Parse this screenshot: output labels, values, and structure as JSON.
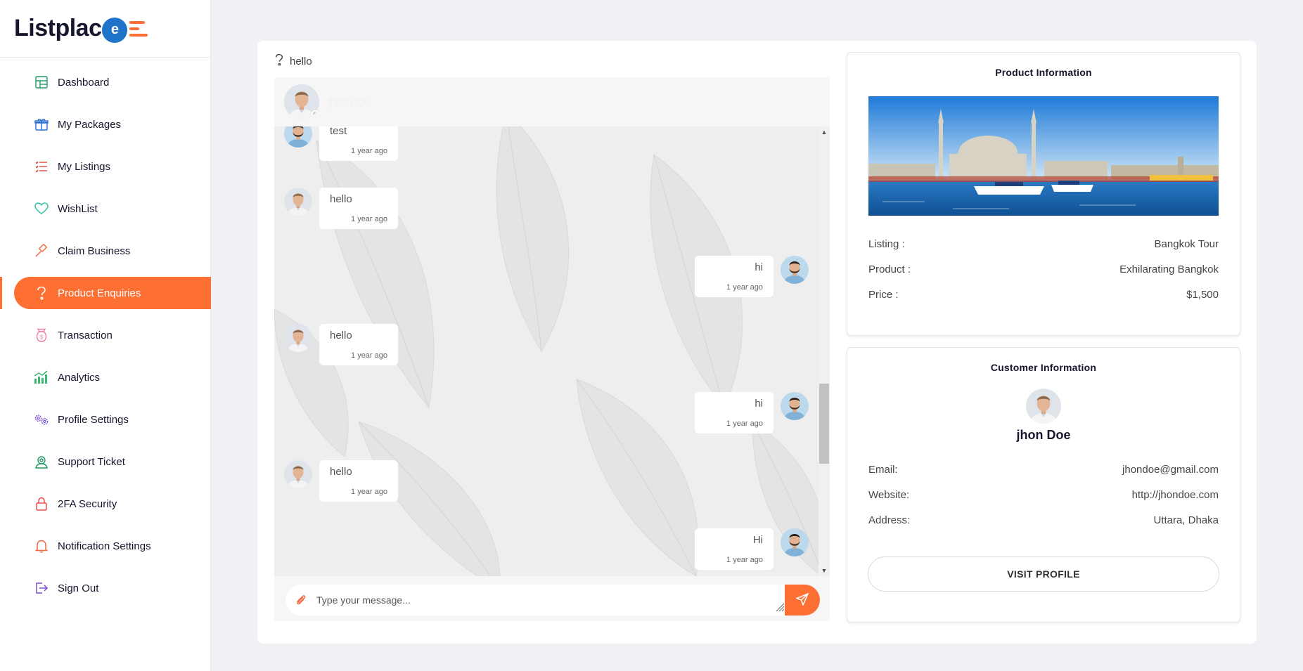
{
  "brand": {
    "logo_prefix": "Listplac",
    "logo_letter": "e"
  },
  "sidebar": {
    "items": [
      {
        "label": "Dashboard",
        "icon": "dashboard-icon",
        "active": false
      },
      {
        "label": "My Packages",
        "icon": "package-icon",
        "active": false
      },
      {
        "label": "My Listings",
        "icon": "list-icon",
        "active": false
      },
      {
        "label": "WishList",
        "icon": "heart-icon",
        "active": false
      },
      {
        "label": "Claim Business",
        "icon": "gavel-icon",
        "active": false
      },
      {
        "label": "Product Enquiries",
        "icon": "question-icon",
        "active": true
      },
      {
        "label": "Transaction",
        "icon": "money-bag-icon",
        "active": false
      },
      {
        "label": "Analytics",
        "icon": "bar-chart-icon",
        "active": false
      },
      {
        "label": "Profile Settings",
        "icon": "gears-icon",
        "active": false
      },
      {
        "label": "Support Ticket",
        "icon": "support-icon",
        "active": false
      },
      {
        "label": "2FA Security",
        "icon": "lock-icon",
        "active": false
      },
      {
        "label": "Notification Settings",
        "icon": "bell-icon",
        "active": false
      },
      {
        "label": "Sign Out",
        "icon": "sign-out-icon",
        "active": false
      }
    ]
  },
  "chat": {
    "subject": "hello",
    "header_name": "jhon Doe",
    "messages": [
      {
        "direction": "in",
        "text": "test",
        "time": "1 year ago"
      },
      {
        "direction": "in",
        "text": "hello",
        "time": "1 year ago"
      },
      {
        "direction": "out",
        "text": "hi",
        "time": "1 year ago"
      },
      {
        "direction": "in",
        "text": "hello",
        "time": "1 year ago"
      },
      {
        "direction": "out",
        "text": "hi",
        "time": "1 year ago"
      },
      {
        "direction": "in",
        "text": "hello",
        "time": "1 year ago"
      },
      {
        "direction": "out",
        "text": "Hi",
        "time": "1 year ago"
      }
    ],
    "input_placeholder": "Type your message..."
  },
  "product_info": {
    "title": "Product Information",
    "rows": [
      {
        "label": "Listing :",
        "value": "Bangkok Tour"
      },
      {
        "label": "Product :",
        "value": "Exhilarating Bangkok"
      },
      {
        "label": "Price :",
        "value": "$1,500"
      }
    ]
  },
  "customer_info": {
    "title": "Customer Information",
    "name": "jhon Doe",
    "rows": [
      {
        "label": "Email:",
        "value": "jhondoe@gmail.com"
      },
      {
        "label": "Website:",
        "value": "http://jhondoe.com"
      },
      {
        "label": "Address:",
        "value": "Uttara, Dhaka"
      }
    ],
    "button_label": "VISIT PROFILE"
  },
  "colors": {
    "accent": "#fe6f33",
    "brand_blue": "#1f73c9",
    "dark": "#16162e"
  }
}
